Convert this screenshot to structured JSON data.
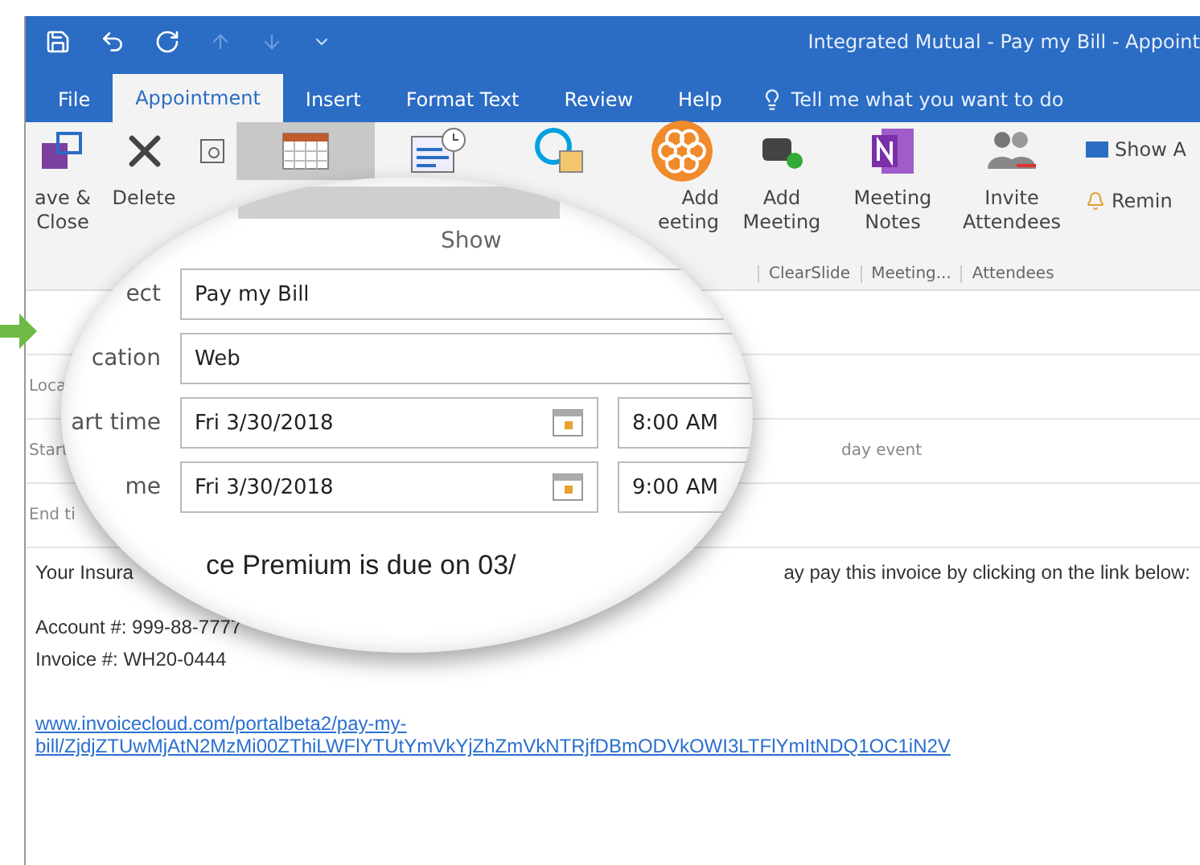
{
  "window": {
    "title": "Integrated Mutual - Pay my Bill  -  Appoint"
  },
  "tabs": [
    {
      "label": "File",
      "selected": false
    },
    {
      "label": "Appointment",
      "selected": true
    },
    {
      "label": "Insert",
      "selected": false
    },
    {
      "label": "Format Text",
      "selected": false
    },
    {
      "label": "Review",
      "selected": false
    },
    {
      "label": "Help",
      "selected": false
    }
  ],
  "tell_me": {
    "placeholder": "Tell me what you want to do"
  },
  "ribbon": [
    {
      "kind": "save",
      "label": [
        "ave &",
        "Close"
      ],
      "selected": false
    },
    {
      "kind": "delete",
      "label": [
        "Delete"
      ],
      "selected": false
    },
    {
      "kind": "small",
      "selected": false
    },
    {
      "kind": "calendar",
      "selected": true
    },
    {
      "kind": "schedule",
      "selected": false
    },
    {
      "kind": "skype",
      "selected": false
    },
    {
      "kind": "flower",
      "label": [
        "Add",
        "eeting"
      ],
      "selected": false
    },
    {
      "kind": "clearslide",
      "label": [
        "Add",
        "Meeting"
      ],
      "selected": false
    },
    {
      "kind": "onenote",
      "label": [
        "Meeting",
        "Notes"
      ],
      "selected": false
    },
    {
      "kind": "attendees",
      "label": [
        "Invite",
        "Attendees"
      ],
      "selected": false
    },
    {
      "kind": "options",
      "label": "Show A",
      "label_2": "Remin"
    }
  ],
  "group_labels": [
    "ClearSlide",
    "Meeting...",
    "Attendees"
  ],
  "form_labels": [
    "Loca",
    "Start",
    "End ti"
  ],
  "all_day": "day event",
  "lens": {
    "group_label": "Show",
    "fields": [
      {
        "label": "ect",
        "value": "Pay my Bill"
      },
      {
        "label": "cation",
        "value": "Web"
      },
      {
        "label": "art time",
        "value": "Fri 3/30/2018",
        "time": "8:00 AM"
      },
      {
        "label": "me",
        "value": "Fri 3/30/2018",
        "time": "9:00 AM"
      }
    ],
    "body_text": "ce Premium is due on 03/"
  },
  "body": {
    "line_start": "Your Insura",
    "line_end": "ay pay this invoice by clicking on the link below:",
    "lines": [
      "Account #: 999-88-7777",
      "Invoice #: WH20-0444"
    ],
    "link": [
      "www.invoicecloud.com/portalbeta2/pay-my-",
      "bill/ZjdjZTUwMjAtN2MzMi00ZThiLWFlYTUtYmVkYjZhZmVkNTRjfDBmODVkOWI3LTFlYmItNDQ1OC1iN2V"
    ]
  }
}
